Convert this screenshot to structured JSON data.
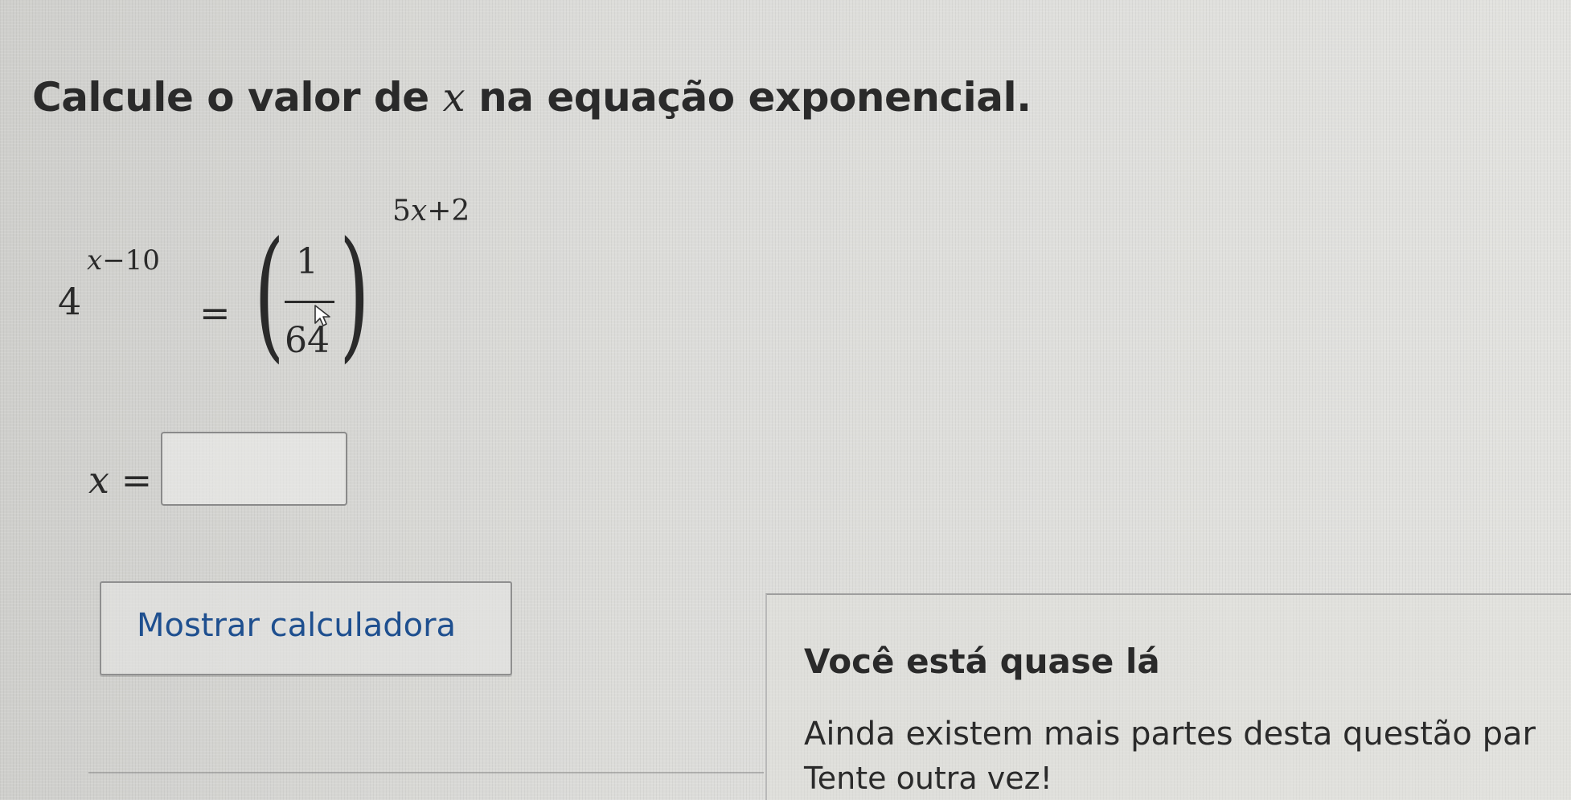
{
  "question": {
    "prompt_before": "Calcule o valor de ",
    "prompt_var": "x",
    "prompt_after": " na equação exponencial."
  },
  "equation": {
    "left_base": "4",
    "left_exponent_var": "x",
    "left_exponent_rest": "−10",
    "equals": "=",
    "paren_open": "(",
    "paren_close": ")",
    "fraction_numerator": "1",
    "fraction_denominator": "64",
    "right_exponent_coef": "5",
    "right_exponent_var": "x",
    "right_exponent_rest": "+2"
  },
  "answer": {
    "label_var": "x",
    "label_equals": "=",
    "input_value": ""
  },
  "calculator": {
    "button_label": "Mostrar calculadora"
  },
  "feedback": {
    "title": "Você está quase lá",
    "body": "Ainda existem mais partes desta questão par",
    "retry": "Tente outra vez!"
  },
  "colors": {
    "link_blue": "#1e4f8f",
    "text": "#2a2a2a",
    "background": "#d9d9d6"
  }
}
